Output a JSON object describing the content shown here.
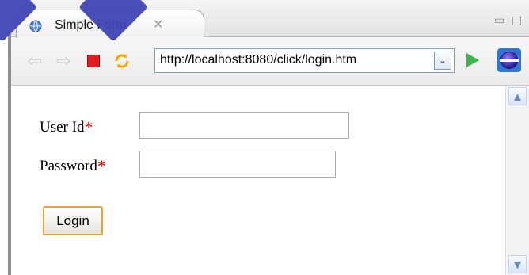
{
  "tab": {
    "title": "Simple Form",
    "close": "✕"
  },
  "window": {
    "minimize": "▭",
    "maximize": "□"
  },
  "toolbar": {
    "url": "http://localhost:8080/click/login.htm",
    "dropdown": "⌄",
    "back_icon": "⇦",
    "forward_icon": "⇨"
  },
  "form": {
    "user_label": "User Id",
    "password_label": "Password",
    "required_mark": "*",
    "login_label": "Login"
  },
  "colors": {
    "required": "#cc0000",
    "button_border": "#e8a33a",
    "go": "#39b54a",
    "stop": "#e31b23"
  }
}
